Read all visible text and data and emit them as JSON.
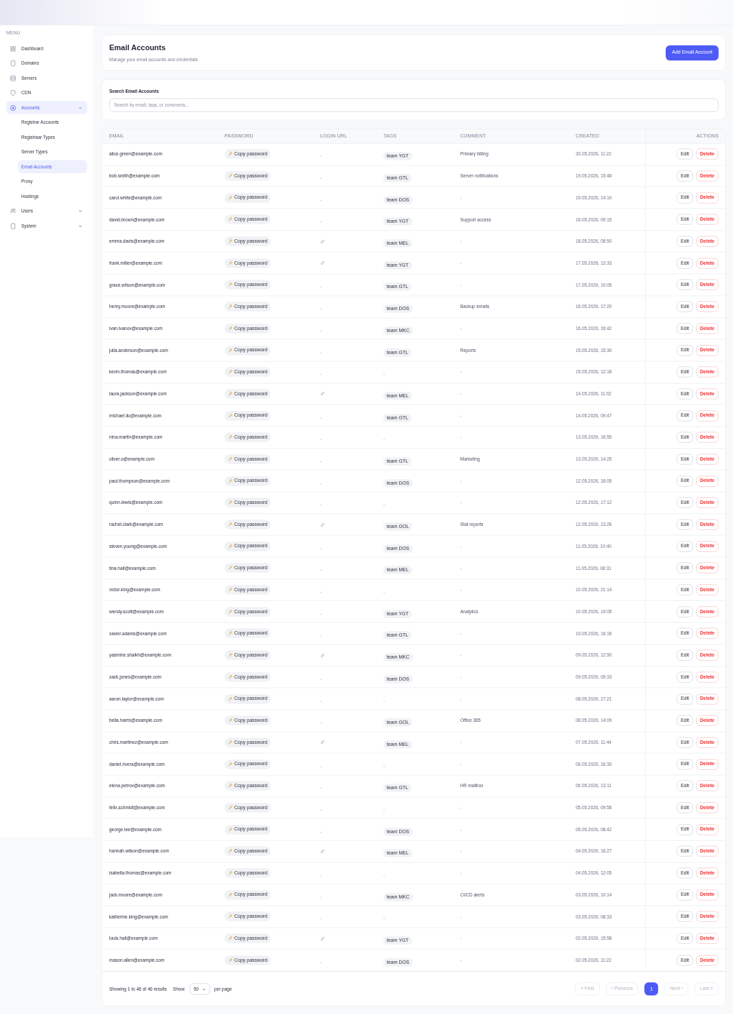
{
  "sidebar": {
    "heading": "MENU",
    "items": [
      {
        "label": "Dashboard",
        "selected": false
      },
      {
        "label": "Domains",
        "selected": false
      },
      {
        "label": "Servers",
        "selected": false
      },
      {
        "label": "CDN",
        "selected": false
      },
      {
        "label": "Accounts",
        "selected": true,
        "expanded": true,
        "children": [
          {
            "label": "Registrar Accounts",
            "selected": false
          },
          {
            "label": "Registraar Types",
            "selected": false
          },
          {
            "label": "Server Types",
            "selected": false
          },
          {
            "label": "Email Accounts",
            "selected": true
          },
          {
            "label": "Proxy",
            "selected": false
          },
          {
            "label": "Hostings",
            "selected": false
          }
        ]
      },
      {
        "label": "Users",
        "selected": false,
        "expanded": false
      },
      {
        "label": "System",
        "selected": false,
        "expanded": false
      }
    ]
  },
  "header": {
    "title": "Email Accounts",
    "subtitle": "Manage your email accounts and credentials",
    "add_button": "Add Email Account"
  },
  "search": {
    "label": "Search Email Accounts",
    "placeholder": "Search by email, tags, or comments..."
  },
  "table": {
    "columns": [
      "EMAIL",
      "PASSWORD",
      "LOGIN URL",
      "TAGS",
      "COMMENT",
      "CREATED",
      "ACTIONS"
    ],
    "rows": [
      {
        "email": "alice.green@example.com",
        "copy": "Copy password",
        "login_url": "-",
        "tag": "team YGT",
        "comment": "Primary billing",
        "created": "20.05.2026, 11:22",
        "edit": "Edit",
        "delete": "Delete"
      },
      {
        "email": "bob.smith@example.com",
        "copy": "Copy password",
        "login_url": "-",
        "tag": "team GTL",
        "comment": "Server notifications",
        "created": "19.05.2026, 15:48",
        "edit": "Edit",
        "delete": "Delete"
      },
      {
        "email": "carol.white@example.com",
        "copy": "Copy password",
        "login_url": "-",
        "tag": "team DOS",
        "comment": "-",
        "created": "19.05.2026, 14:10",
        "edit": "Edit",
        "delete": "Delete"
      },
      {
        "email": "david.brown@example.com",
        "copy": "Copy password",
        "login_url": "-",
        "tag": "team YGT",
        "comment": "Support access",
        "created": "18.05.2026, 09:15",
        "edit": "Edit",
        "delete": "Delete"
      },
      {
        "email": "emma.davis@example.com",
        "copy": "Copy password",
        "login_link": true,
        "tag": "team MEL",
        "comment": "-",
        "created": "18.05.2026, 08:50",
        "edit": "Edit",
        "delete": "Delete"
      },
      {
        "email": "frank.miller@example.com",
        "copy": "Copy password",
        "login_link": true,
        "tag": "team YGT",
        "comment": "-",
        "created": "17.05.2026, 13:33",
        "edit": "Edit",
        "delete": "Delete"
      },
      {
        "email": "grace.wilson@example.com",
        "copy": "Copy password",
        "login_url": "-",
        "tag": "team GTL",
        "comment": "-",
        "created": "17.05.2026, 10:05",
        "edit": "Edit",
        "delete": "Delete"
      },
      {
        "email": "henry.moore@example.com",
        "copy": "Copy password",
        "login_url": "-",
        "tag": "team DOS",
        "comment": "Backup emails",
        "created": "16.05.2026, 17:20",
        "edit": "Edit",
        "delete": "Delete"
      },
      {
        "email": "ivan.ivanov@example.com",
        "copy": "Copy password",
        "login_url": "-",
        "tag": "team MKC",
        "comment": "-",
        "created": "16.05.2026, 16:42",
        "edit": "Edit",
        "delete": "Delete"
      },
      {
        "email": "julia.anderson@example.com",
        "copy": "Copy password",
        "login_url": "-",
        "tag": "team GTL",
        "comment": "Reports",
        "created": "15.05.2026, 15:30",
        "edit": "Edit",
        "delete": "Delete"
      },
      {
        "email": "kevin.thomas@example.com",
        "copy": "Copy password",
        "login_url": "-",
        "no_tag": "-",
        "comment": "-",
        "created": "15.05.2026, 12:18",
        "edit": "Edit",
        "delete": "Delete"
      },
      {
        "email": "laura.jackson@example.com",
        "copy": "Copy password",
        "login_link": true,
        "tag": "team MEL",
        "comment": "-",
        "created": "14.05.2026, 11:02",
        "edit": "Edit",
        "delete": "Delete"
      },
      {
        "email": "michael.liu@example.com",
        "copy": "Copy password",
        "login_url": "-",
        "tag": "team GTL",
        "comment": "-",
        "created": "14.05.2026, 09:47",
        "edit": "Edit",
        "delete": "Delete"
      },
      {
        "email": "nina.martin@example.com",
        "copy": "Copy password",
        "login_url": "-",
        "no_tag": "-",
        "comment": "-",
        "created": "13.05.2026, 16:55",
        "edit": "Edit",
        "delete": "Delete"
      },
      {
        "email": "oliver.o@example.com",
        "copy": "Copy password",
        "login_url": "-",
        "tag": "team GTL",
        "comment": "Marketing",
        "created": "13.05.2026, 14:25",
        "edit": "Edit",
        "delete": "Delete"
      },
      {
        "email": "paul.thompson@example.com",
        "copy": "Copy password",
        "login_url": "-",
        "tag": "team DOS",
        "comment": "-",
        "created": "12.05.2026, 18:05",
        "edit": "Edit",
        "delete": "Delete"
      },
      {
        "email": "quinn.lewis@example.com",
        "copy": "Copy password",
        "login_url": "-",
        "no_tag": "-",
        "comment": "-",
        "created": "12.05.2026, 17:12",
        "edit": "Edit",
        "delete": "Delete"
      },
      {
        "email": "rachel.clark@example.com",
        "copy": "Copy password",
        "login_link": true,
        "tag": "team GOL",
        "comment": "Stat reports",
        "created": "12.05.2026, 13:26",
        "edit": "Edit",
        "delete": "Delete"
      },
      {
        "email": "steven.young@example.com",
        "copy": "Copy password",
        "login_url": "-",
        "tag": "team DOS",
        "comment": "-",
        "created": "11.05.2026, 10:40",
        "edit": "Edit",
        "delete": "Delete"
      },
      {
        "email": "tina.hall@example.com",
        "copy": "Copy password",
        "login_url": "-",
        "tag": "team MEL",
        "comment": "-",
        "created": "11.05.2026, 08:31",
        "edit": "Edit",
        "delete": "Delete"
      },
      {
        "email": "victor.king@example.com",
        "copy": "Copy password",
        "login_url": "-",
        "no_tag": "-",
        "comment": "-",
        "created": "10.05.2026, 21:14",
        "edit": "Edit",
        "delete": "Delete"
      },
      {
        "email": "wendy.scott@example.com",
        "copy": "Copy password",
        "login_url": "-",
        "tag": "team YGT",
        "comment": "Analytics",
        "created": "10.05.2026, 19:05",
        "edit": "Edit",
        "delete": "Delete"
      },
      {
        "email": "xavier.adams@example.com",
        "copy": "Copy password",
        "login_url": "-",
        "tag": "team GTL",
        "comment": "-",
        "created": "10.05.2026, 16:18",
        "edit": "Edit",
        "delete": "Delete"
      },
      {
        "email": "yasmine.shaikh@example.com",
        "copy": "Copy password",
        "login_link": true,
        "tag": "team MKC",
        "comment": "-",
        "created": "09.05.2026, 12:50",
        "edit": "Edit",
        "delete": "Delete"
      },
      {
        "email": "zack.jones@example.com",
        "copy": "Copy password",
        "login_url": "-",
        "tag": "team DOS",
        "comment": "-",
        "created": "09.05.2026, 09:33",
        "edit": "Edit",
        "delete": "Delete"
      },
      {
        "email": "aaron.taylor@example.com",
        "copy": "Copy password",
        "login_url": "-",
        "no_tag": "-",
        "comment": "-",
        "created": "08.05.2026, 17:21",
        "edit": "Edit",
        "delete": "Delete"
      },
      {
        "email": "bella.harris@example.com",
        "copy": "Copy password",
        "login_url": "-",
        "tag": "team GOL",
        "comment": "Office 365",
        "created": "08.05.2026, 14:09",
        "edit": "Edit",
        "delete": "Delete"
      },
      {
        "email": "chris.martinez@example.com",
        "copy": "Copy password",
        "login_link": true,
        "tag": "team MEL",
        "comment": "-",
        "created": "07.05.2026, 11:44",
        "edit": "Edit",
        "delete": "Delete"
      },
      {
        "email": "daniel.rivera@example.com",
        "copy": "Copy password",
        "login_url": "-",
        "no_tag": "-",
        "comment": "-",
        "created": "06.05.2026, 16:30",
        "edit": "Edit",
        "delete": "Delete"
      },
      {
        "email": "elena.petrov@example.com",
        "copy": "Copy password",
        "login_url": "-",
        "tag": "team GTL",
        "comment": "HR mailbox",
        "created": "06.05.2026, 13:11",
        "edit": "Edit",
        "delete": "Delete"
      },
      {
        "email": "felix.schmidt@example.com",
        "copy": "Copy password",
        "login_url": "-",
        "no_tag": "-",
        "comment": "-",
        "created": "05.05.2026, 09:58",
        "edit": "Edit",
        "delete": "Delete"
      },
      {
        "email": "george.lee@example.com",
        "copy": "Copy password",
        "login_url": "-",
        "tag": "team DOS",
        "comment": "-",
        "created": "05.05.2026, 08:42",
        "edit": "Edit",
        "delete": "Delete"
      },
      {
        "email": "hannah.wilson@example.com",
        "copy": "Copy password",
        "login_link": true,
        "tag": "team MEL",
        "comment": "-",
        "created": "04.05.2026, 16:27",
        "edit": "Edit",
        "delete": "Delete"
      },
      {
        "email": "isabella.thomas@example.com",
        "copy": "Copy password",
        "login_url": "-",
        "no_tag": "-",
        "comment": "-",
        "created": "04.05.2026, 12:05",
        "edit": "Edit",
        "delete": "Delete"
      },
      {
        "email": "jack.moore@example.com",
        "copy": "Copy password",
        "login_url": "-",
        "tag": "team MKC",
        "comment": "CI/CD alerts",
        "created": "03.05.2026, 10:14",
        "edit": "Edit",
        "delete": "Delete"
      },
      {
        "email": "katherine.king@example.com",
        "copy": "Copy password",
        "login_url": "-",
        "no_tag": "-",
        "comment": "-",
        "created": "03.05.2026, 08:33",
        "edit": "Edit",
        "delete": "Delete"
      },
      {
        "email": "louis.hall@example.com",
        "copy": "Copy password",
        "login_link": true,
        "tag": "team YGT",
        "comment": "-",
        "created": "02.05.2026, 15:58",
        "edit": "Edit",
        "delete": "Delete"
      },
      {
        "email": "mason.allen@example.com",
        "copy": "Copy password",
        "login_url": "-",
        "tag": "team DOS",
        "comment": "-",
        "created": "02.05.2026, 11:22",
        "edit": "Edit",
        "delete": "Delete"
      }
    ]
  },
  "footer": {
    "summary": "Showing 1 to 46 of 46 results",
    "show_label": "Show:",
    "page_size": "50",
    "per_page": "per page",
    "pages": [
      {
        "label": "« First",
        "kind": "nav",
        "disabled": true,
        "selected": false
      },
      {
        "label": "‹ Previous",
        "kind": "nav",
        "disabled": true,
        "selected": false
      },
      {
        "label": "1",
        "kind": "page",
        "selected": true
      },
      {
        "label": "Next ›",
        "kind": "nav",
        "disabled": true,
        "selected": false
      },
      {
        "label": "Last »",
        "kind": "nav",
        "disabled": true,
        "selected": false
      }
    ]
  }
}
